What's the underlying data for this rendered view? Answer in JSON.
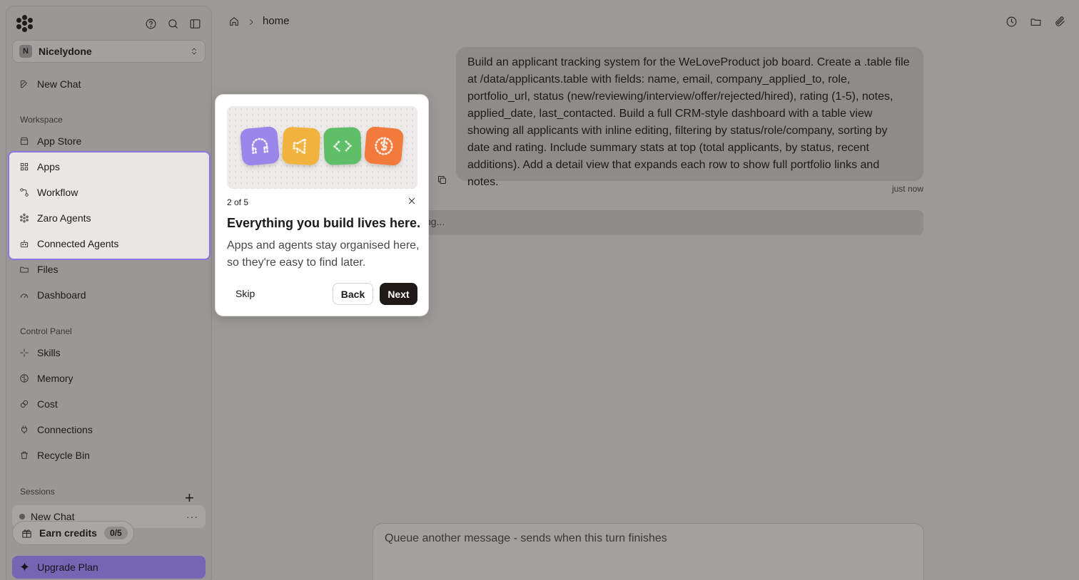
{
  "sidebar": {
    "workspace": {
      "avatar_letter": "N",
      "name": "Nicelydone"
    },
    "new_chat": "New Chat",
    "workspace_label": "Workspace",
    "workspace_items": [
      {
        "label": "App Store",
        "icon": "store-icon"
      },
      {
        "label": "Apps",
        "icon": "grid-icon"
      },
      {
        "label": "Workflow",
        "icon": "workflow-icon"
      },
      {
        "label": "Zaro Agents",
        "icon": "agents-icon"
      },
      {
        "label": "Connected Agents",
        "icon": "robot-icon"
      },
      {
        "label": "Files",
        "icon": "folder-icon"
      },
      {
        "label": "Dashboard",
        "icon": "gauge-icon"
      }
    ],
    "control_panel_label": "Control Panel",
    "control_items": [
      {
        "label": "Skills",
        "icon": "sparkle-icon"
      },
      {
        "label": "Memory",
        "icon": "brain-icon"
      },
      {
        "label": "Cost",
        "icon": "coin-icon"
      },
      {
        "label": "Connections",
        "icon": "plug-icon"
      },
      {
        "label": "Recycle Bin",
        "icon": "trash-icon"
      }
    ],
    "sessions_label": "Sessions",
    "session_item": "New Chat",
    "earn": {
      "label": "Earn credits",
      "count": "0/5"
    },
    "upgrade": "Upgrade Plan"
  },
  "header": {
    "breadcrumb": "home"
  },
  "chat": {
    "user_message": "Build an applicant tracking system for the WeLoveProduct job board. Create a .table file at /data/applicants.table with fields: name, email, company_applied_to, role, portfolio_url, status (new/reviewing/interview/offer/rejected/hired), rating (1-5), notes, applied_date, last_contacted. Build a full CRM-style dashboard with a table view showing all applicants with inline editing, filtering by status/role/company, sorting by date and rating. Include summary stats at top (total applicants, by status, recent additions). Add a detail view that expands each row to show full portfolio links and notes.",
    "timestamp": "just now",
    "thinking": "ng..."
  },
  "composer": {
    "placeholder": "Queue another message - sends when this turn finishes"
  },
  "tour": {
    "step": "2 of 5",
    "title": "Everything you build lives here.",
    "body": "Apps and agents stay organised here, so they're easy to find later.",
    "skip": "Skip",
    "back": "Back",
    "next": "Next"
  },
  "colors": {
    "highlight": "#8c74e4",
    "upgrade": "#7665b3",
    "tile_purple": "#9a86e8",
    "tile_yellow": "#f2b23e",
    "tile_green": "#5fbf68",
    "tile_orange": "#f27a3d"
  }
}
